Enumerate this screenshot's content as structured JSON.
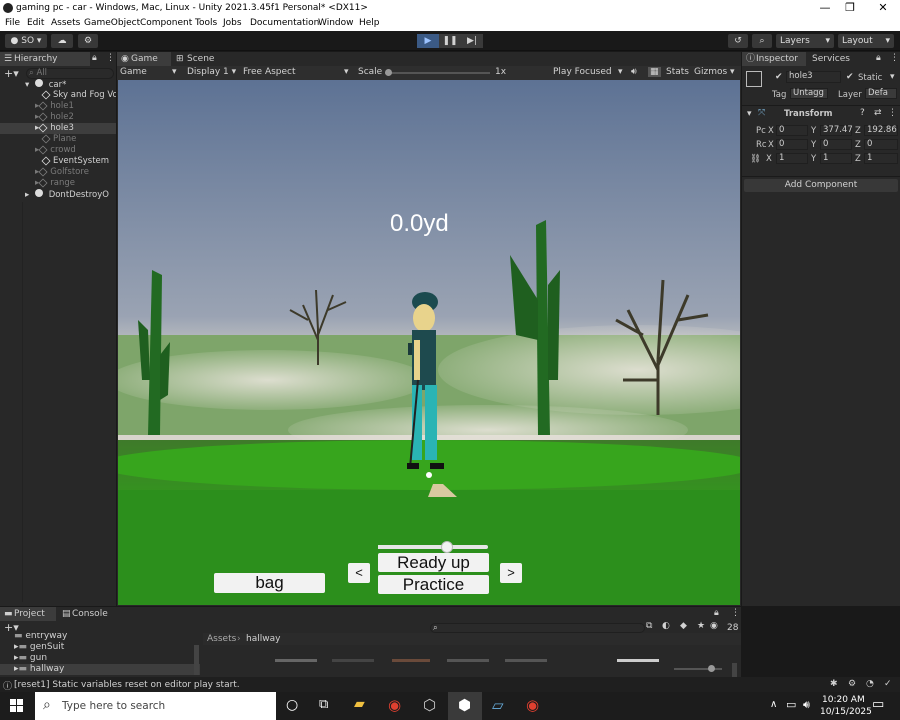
{
  "window": {
    "title": "gaming pc - car - Windows, Mac, Linux - Unity 2021.3.45f1 Personal* <DX11>",
    "controls": [
      "—",
      "❐",
      "✕"
    ]
  },
  "menu": [
    "File",
    "Edit",
    "Assets",
    "GameObject",
    "Component",
    "Tools",
    "Jobs",
    "Documentation",
    "Window",
    "Help"
  ],
  "toolbar": {
    "account": "SO",
    "layers": "Layers",
    "layout": "Layout"
  },
  "hierarchy": {
    "tab": "Hierarchy",
    "search_placeholder": "All",
    "items": [
      {
        "label": "car*",
        "indent": 0
      },
      {
        "label": "Sky and Fog Vo",
        "indent": 1
      },
      {
        "label": "hole1",
        "indent": 1
      },
      {
        "label": "hole2",
        "indent": 1
      },
      {
        "label": "hole3",
        "indent": 1
      },
      {
        "label": "Plane",
        "indent": 1
      },
      {
        "label": "crowd",
        "indent": 1
      },
      {
        "label": "EventSystem",
        "indent": 1
      },
      {
        "label": "Golfstore",
        "indent": 1
      },
      {
        "label": "range",
        "indent": 1
      },
      {
        "label": "DontDestroyO",
        "indent": 0
      }
    ]
  },
  "game": {
    "tabs": [
      "Game",
      "Scene"
    ],
    "mode": "Game",
    "display": "Display 1",
    "aspect": "Free Aspect",
    "scale_label": "Scale",
    "scale_value": "1x",
    "play_focused": "Play Focused",
    "stats": "Stats",
    "gizmos": "Gizmos",
    "distance": "0.0yd",
    "ready_label": "Ready up",
    "practice_label": "Practice",
    "bag_label": "bag",
    "prev_label": "<",
    "next_label": ">",
    "power": 0.63
  },
  "inspector": {
    "tabs": [
      "Inspector",
      "Services"
    ],
    "object_name": "hole3",
    "static_label": "Static",
    "tag_label": "Tag",
    "tag_value": "Untagg",
    "layer_label": "Layer",
    "layer_value": "Defa",
    "component": "Transform",
    "position": {
      "label": "Pc",
      "x": "0",
      "y": "377.47",
      "z": "192.86"
    },
    "rotation": {
      "label": "Rc",
      "x": "0",
      "y": "0",
      "z": "0"
    },
    "scale": {
      "x": "1",
      "y": "1",
      "z": "1"
    },
    "add_component": "Add Component"
  },
  "project": {
    "tabs": [
      "Project",
      "Console"
    ],
    "folders": [
      "entryway",
      "genSuit",
      "gun",
      "hallway"
    ],
    "breadcrumb_root": "Assets",
    "breadcrumb_current": "hallway",
    "badge": "28"
  },
  "status": {
    "message": "[reset1] Static variables reset on editor play start."
  },
  "taskbar": {
    "search_placeholder": "Type here to search",
    "time": "10:20 AM",
    "date": "10/15/2025"
  }
}
